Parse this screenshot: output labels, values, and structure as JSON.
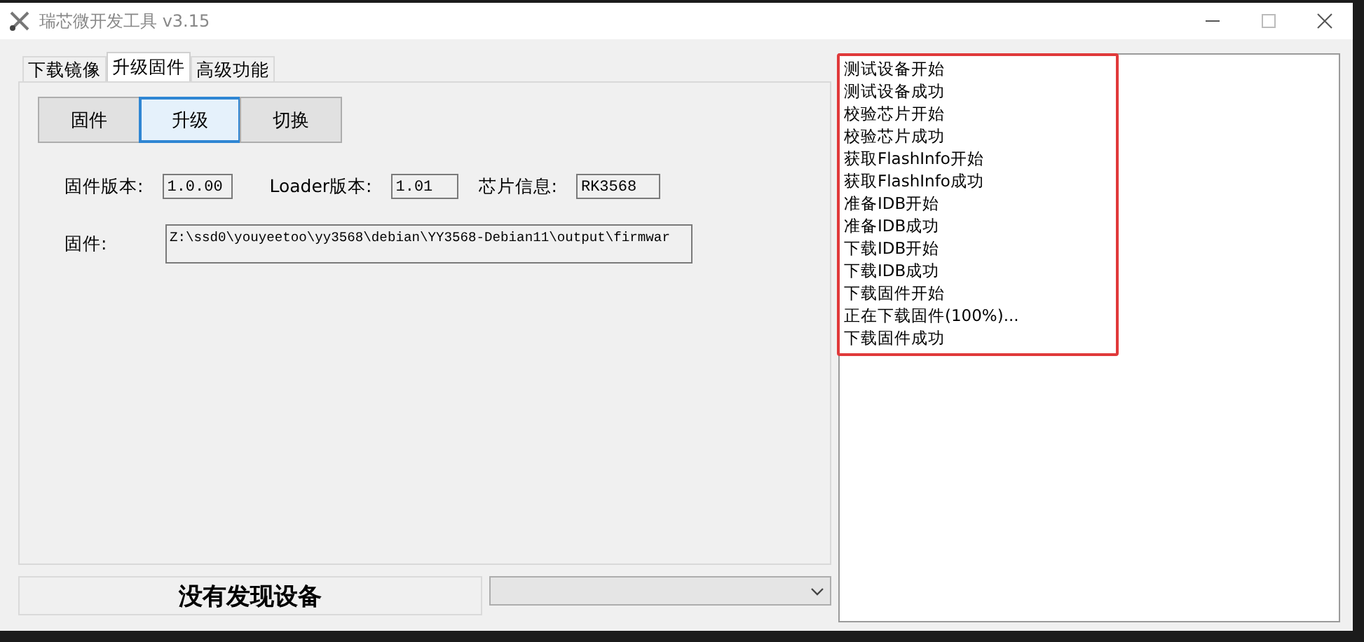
{
  "window": {
    "title": "瑞芯微开发工具 v3.15"
  },
  "tabs": [
    {
      "label": "下载镜像",
      "selected": false
    },
    {
      "label": "升级固件",
      "selected": true
    },
    {
      "label": "高级功能",
      "selected": false
    }
  ],
  "action_buttons": [
    {
      "label": "固件",
      "focused": false
    },
    {
      "label": "升级",
      "focused": true
    },
    {
      "label": "切换",
      "focused": false
    }
  ],
  "info_fields": [
    {
      "label": "固件版本:",
      "value": "1.0.00"
    },
    {
      "label": "Loader版本:",
      "value": "1.01"
    },
    {
      "label": "芯片信息:",
      "value": "RK3568"
    }
  ],
  "firmware_path": {
    "label": "固件:",
    "value": "Z:\\ssd0\\youyeetoo\\yy3568\\debian\\YY3568-Debian11\\output\\firmwar"
  },
  "status": "没有发现设备",
  "log": {
    "highlighted": true,
    "lines": [
      "测试设备开始",
      "测试设备成功",
      "校验芯片开始",
      "校验芯片成功",
      "获取FlashInfo开始",
      "获取FlashInfo成功",
      "准备IDB开始",
      "准备IDB成功",
      "下载IDB开始",
      "下载IDB成功",
      "下载固件开始",
      "正在下载固件(100%)...",
      "下载固件成功"
    ]
  }
}
